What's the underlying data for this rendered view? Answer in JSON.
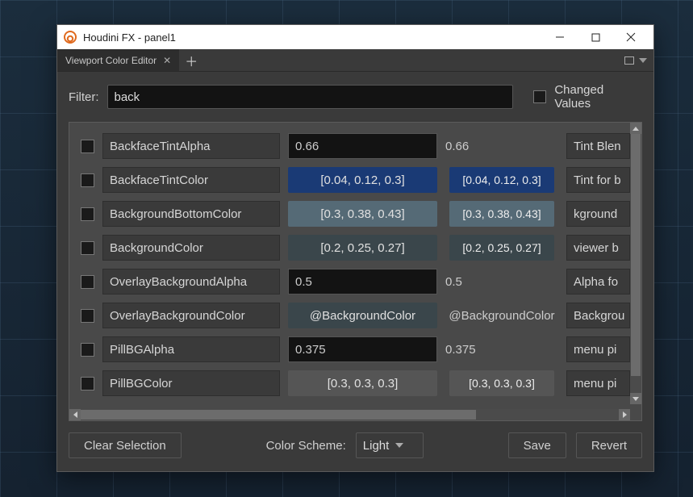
{
  "window": {
    "title": "Houdini FX - panel1"
  },
  "tabs": [
    {
      "label": "Viewport Color Editor"
    }
  ],
  "filter": {
    "label": "Filter:",
    "value": "back",
    "changed_values_label": "Changed Values"
  },
  "columns": [
    "changed",
    "name",
    "value",
    "default",
    "description"
  ],
  "rows": [
    {
      "name": "BackfaceTintAlpha",
      "type": "scalar",
      "value": "0.66",
      "default": "0.66",
      "desc": "Tint Blen"
    },
    {
      "name": "BackfaceTintColor",
      "type": "color",
      "value": "[0.04, 0.12, 0.3]",
      "default": "[0.04, 0.12, 0.3]",
      "swatch": "#1a3a75",
      "def_swatch": "#1a3a75",
      "desc": "Tint for b"
    },
    {
      "name": "BackgroundBottomColor",
      "type": "color",
      "value": "[0.3, 0.38, 0.43]",
      "default": "[0.3, 0.38, 0.43]",
      "swatch": "#556a76",
      "def_swatch": "#556a76",
      "desc": "kground"
    },
    {
      "name": "BackgroundColor",
      "type": "color",
      "value": "[0.2, 0.25, 0.27]",
      "default": "[0.2, 0.25, 0.27]",
      "swatch": "#3a464b",
      "def_swatch": "#3a464b",
      "desc": "viewer b"
    },
    {
      "name": "OverlayBackgroundAlpha",
      "type": "scalar",
      "value": "0.5",
      "default": "0.5",
      "desc": "Alpha fo"
    },
    {
      "name": "OverlayBackgroundColor",
      "type": "ref",
      "value": "@BackgroundColor",
      "default": "@BackgroundColor",
      "swatch": "#3a464b",
      "desc": "Backgrou"
    },
    {
      "name": "PillBGAlpha",
      "type": "scalar",
      "value": "0.375",
      "default": "0.375",
      "desc": "menu pi"
    },
    {
      "name": "PillBGColor",
      "type": "color",
      "value": "[0.3, 0.3, 0.3]",
      "default": "[0.3, 0.3, 0.3]",
      "swatch": "#555555",
      "def_swatch": "#555555",
      "desc": "menu pi"
    }
  ],
  "footer": {
    "clear": "Clear Selection",
    "scheme_label": "Color Scheme:",
    "scheme_value": "Light",
    "save": "Save",
    "revert": "Revert"
  }
}
